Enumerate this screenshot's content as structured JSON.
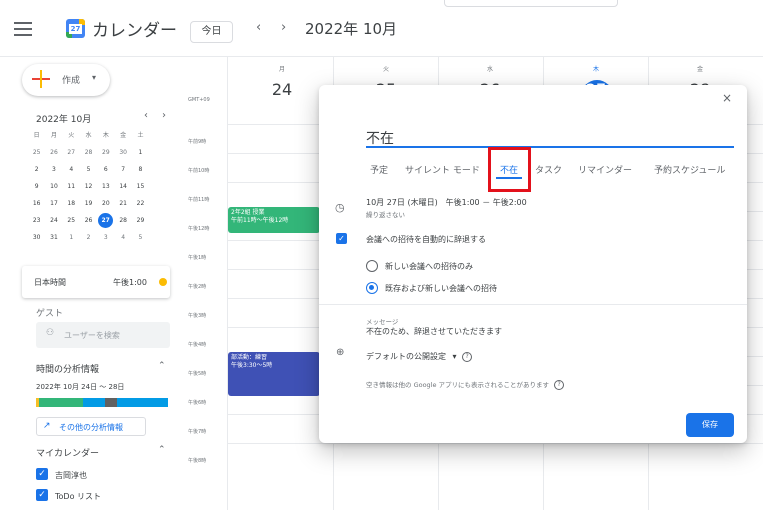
{
  "header": {
    "app_name": "カレンダー",
    "logo_day": "27",
    "today_label": "今日",
    "prev": "‹",
    "next": "›",
    "month_title": "2022年 10月"
  },
  "sidebar": {
    "create_label": "作成",
    "create_caret": "▾",
    "mini_month": "2022年 10月",
    "mini_prev": "‹",
    "mini_next": "›",
    "weekdays": [
      "日",
      "月",
      "火",
      "水",
      "木",
      "金",
      "土"
    ],
    "weeks": [
      [
        "25",
        "26",
        "27",
        "28",
        "29",
        "30",
        "1"
      ],
      [
        "2",
        "3",
        "4",
        "5",
        "6",
        "7",
        "8"
      ],
      [
        "9",
        "10",
        "11",
        "12",
        "13",
        "14",
        "15"
      ],
      [
        "16",
        "17",
        "18",
        "19",
        "20",
        "21",
        "22"
      ],
      [
        "23",
        "24",
        "25",
        "26",
        "27",
        "28",
        "29"
      ],
      [
        "30",
        "31",
        "1",
        "2",
        "3",
        "4",
        "5"
      ]
    ],
    "timezone_label": "日本時間",
    "timezone_time": "午後1:00",
    "guests_label": "ゲスト",
    "search_users_placeholder": "ユーザーを検索",
    "analytics_title": "時間の分析情報",
    "analytics_range": "2022年 10月 24日 ～ 28日",
    "analytics_bar_colors": [
      "#f6bf26",
      "#33b679",
      "#039be5",
      "#616161",
      "#039be5"
    ],
    "more_analytics": "その他の分析情報",
    "my_calendars_title": "マイカレンダー",
    "calendars": [
      "吉岡淳也",
      "ToDo リスト"
    ]
  },
  "grid": {
    "gmt": "GMT+09",
    "days": [
      {
        "name": "月",
        "num": "24"
      },
      {
        "name": "火",
        "num": "25"
      },
      {
        "name": "水",
        "num": "26"
      },
      {
        "name": "木",
        "num": "27"
      },
      {
        "name": "金",
        "num": "28"
      }
    ],
    "times": [
      "午前9時",
      "午前10時",
      "午前11時",
      "午後12時",
      "午後1時",
      "午後2時",
      "午後3時",
      "午後4時",
      "午後5時",
      "午後6時",
      "午後7時",
      "午後8時"
    ],
    "events": [
      {
        "title": "2年2組 授業",
        "time": "午前11時～午後12時",
        "color": "#33b679"
      },
      {
        "title": "部活動：練習",
        "time": "午後3:30～5時",
        "color": "#3f51b5"
      }
    ]
  },
  "dialog": {
    "close": "×",
    "title_value": "不在",
    "tabs": [
      "予定",
      "サイレント モード",
      "不在",
      "タスク",
      "リマインダー",
      "予約スケジュール"
    ],
    "date_line": "10月 27日 (木曜日)　午後1:00 － 午後2:00",
    "repeat": "繰り返さない",
    "auto_decline": "会議への招待を自動的に辞退する",
    "radio_new_only": "新しい会議への招待のみ",
    "radio_existing_new": "既存および新しい会議への招待",
    "message_label": "メッセージ",
    "message_value": "不在のため、辞退させていただきます",
    "visibility": "デフォルトの公開設定",
    "visibility_caret": "▾",
    "availability_note": "空き情報は他の Google アプリにも表示されることがあります",
    "save": "保存"
  },
  "colors": {
    "accent": "#1a73e8",
    "highlight_box": "#e3111b"
  }
}
